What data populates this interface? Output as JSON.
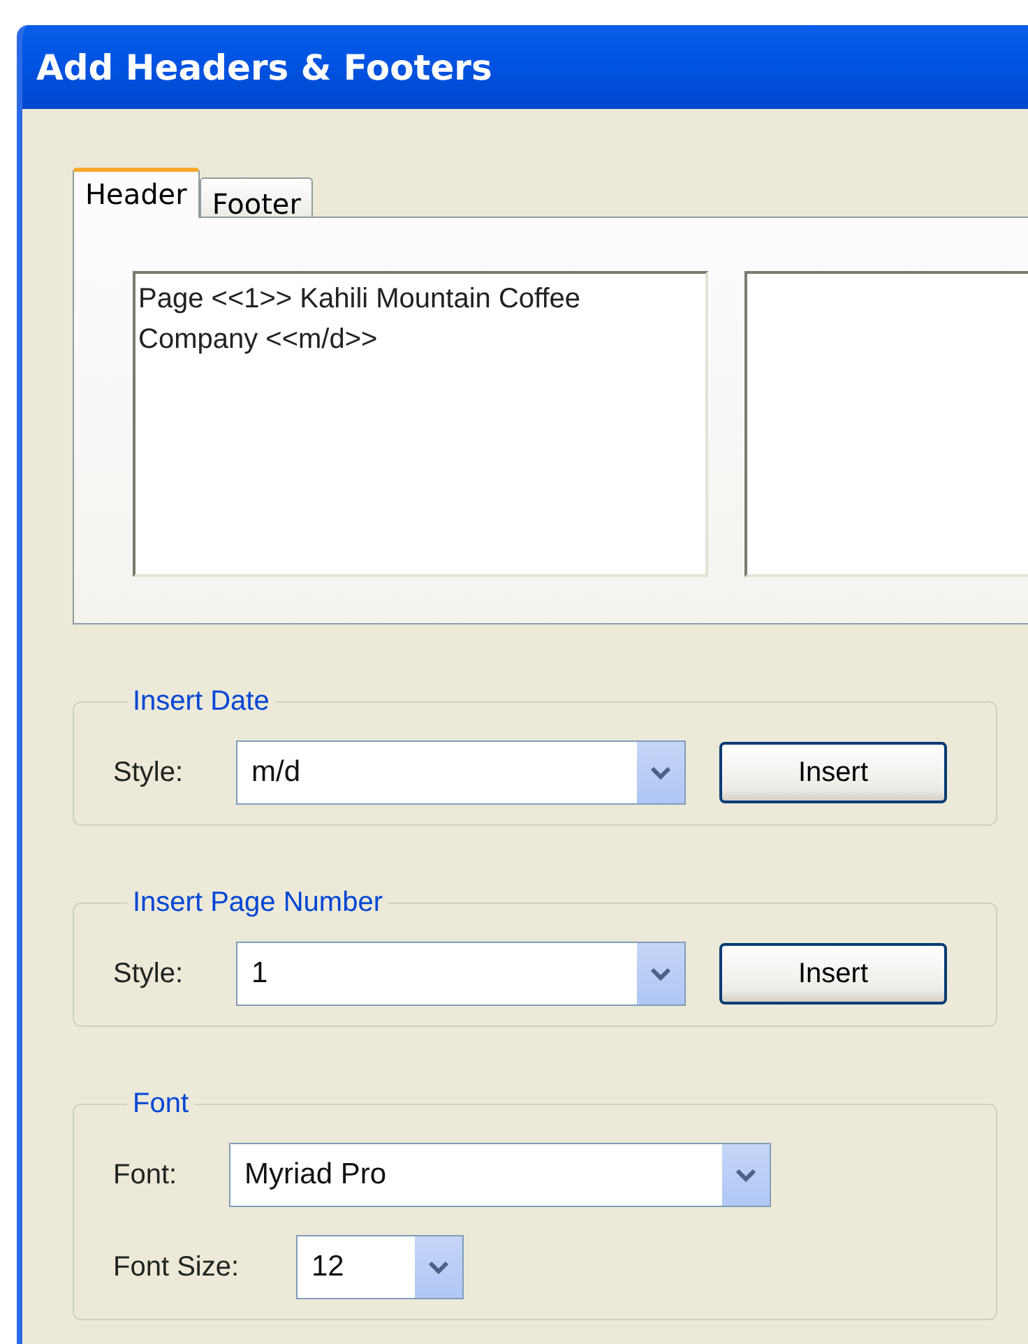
{
  "window": {
    "title": "Add Headers & Footers"
  },
  "tabs": [
    {
      "label": "Header",
      "selected": true
    },
    {
      "label": "Footer",
      "selected": false
    }
  ],
  "header_text": {
    "value": "Page <<1>> Kahili Mountain Coffee Company <<m/d>>"
  },
  "groups": [
    {
      "title": "Insert Date",
      "rows": [
        {
          "kind": "style",
          "label": "Style:",
          "value": "m/d",
          "button": "Insert"
        }
      ]
    },
    {
      "title": "Insert Page Number",
      "rows": [
        {
          "kind": "style",
          "label": "Style:",
          "value": "1",
          "button": "Insert"
        }
      ]
    },
    {
      "title": "Font",
      "rows": [
        {
          "kind": "font",
          "label": "Font:",
          "value": "Myriad Pro"
        },
        {
          "kind": "size",
          "label": "Font Size:",
          "value": "12"
        }
      ]
    }
  ]
}
